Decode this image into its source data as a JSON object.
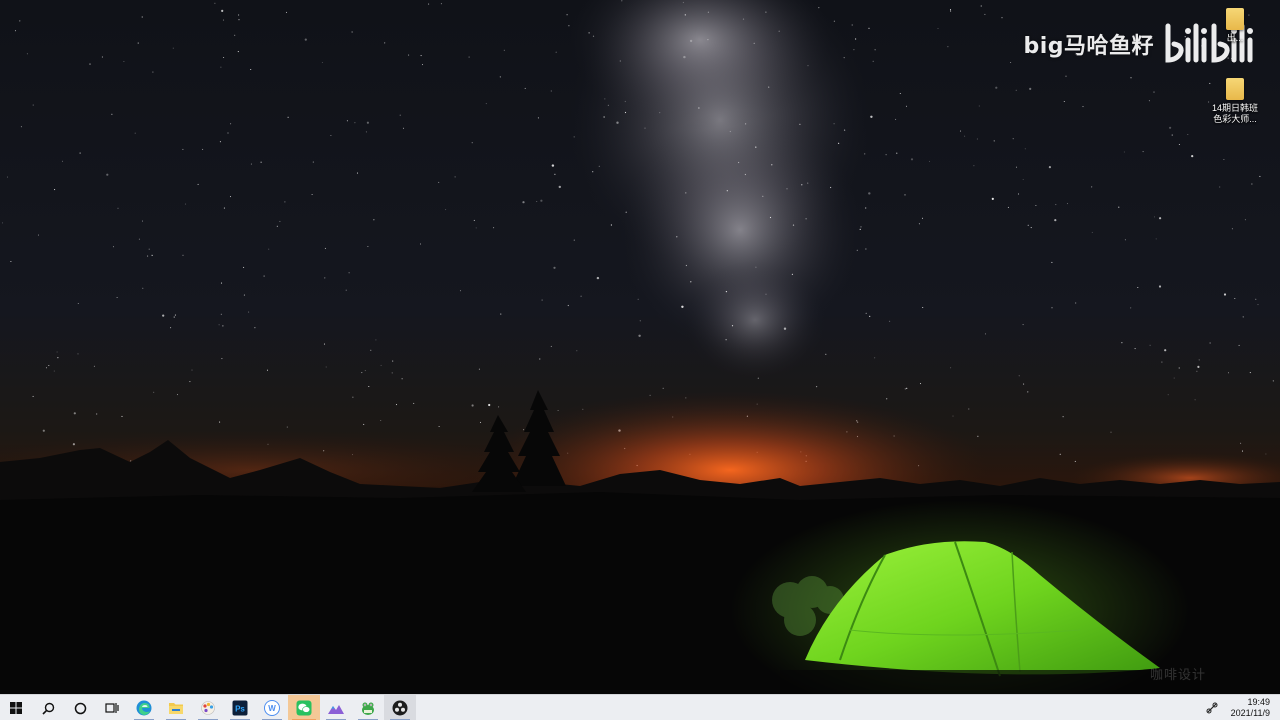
{
  "watermark": {
    "user": "big马哈鱼籽",
    "site_logo_text": "bilibili"
  },
  "desktop_icons": [
    {
      "label": "出...",
      "icon": "folder-icon"
    },
    {
      "label": "14期日韩班\n色彩大师...",
      "icon": "folder-icon"
    }
  ],
  "corner_text": "咖啡设计",
  "taskbar": {
    "items": [
      {
        "name": "start",
        "icon": "windows-logo-icon"
      },
      {
        "name": "search",
        "icon": "search-icon"
      },
      {
        "name": "cortana",
        "icon": "cortana-ring-icon"
      },
      {
        "name": "task-view",
        "icon": "task-view-icon"
      },
      {
        "name": "edge",
        "icon": "edge-icon"
      },
      {
        "name": "file-explorer",
        "icon": "folder-icon"
      },
      {
        "name": "paint",
        "icon": "palette-icon"
      },
      {
        "name": "photoshop",
        "icon": "photoshop-icon",
        "label": "Ps"
      },
      {
        "name": "wps",
        "icon": "wps-icon",
        "label": "W"
      },
      {
        "name": "wechat",
        "icon": "wechat-icon"
      },
      {
        "name": "photos",
        "icon": "mountain-photo-icon"
      },
      {
        "name": "frog-app",
        "icon": "frog-icon"
      },
      {
        "name": "obs",
        "icon": "obs-icon"
      }
    ]
  },
  "tray": {
    "network_icon": "network-icon",
    "time": "19:49",
    "date": "2021/11/9"
  },
  "colors": {
    "taskbar_bg": "#eceef2",
    "tent_green": "#7be02a",
    "horizon_glow": "#e0621e",
    "sky": "#141722"
  }
}
